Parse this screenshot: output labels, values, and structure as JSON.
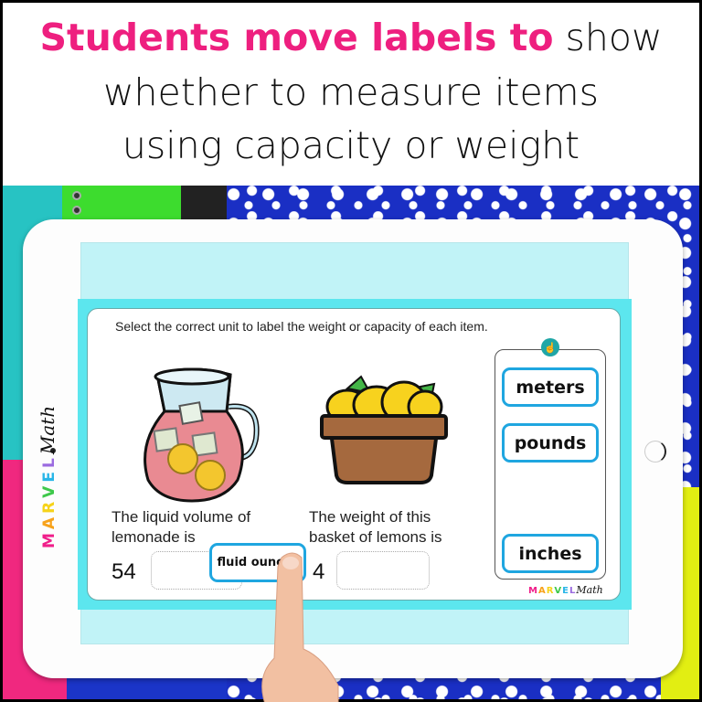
{
  "banner": {
    "line1_highlight": "Students move labels to",
    "line1_rest": " show",
    "line2": "whether to measure items",
    "line3": "using capacity or weight",
    "highlight_color": "#ee1f7f"
  },
  "brand": {
    "letters": [
      "M",
      "A",
      "R",
      "V",
      "E",
      "L"
    ],
    "letter_colors": [
      "#f01f8a",
      "#f7a21b",
      "#f6d31a",
      "#3ec84a",
      "#29b6e8",
      "#9b6be0"
    ],
    "script": "Math"
  },
  "slide": {
    "instruction": "Select the correct unit to label the weight or capacity of each item.",
    "items": [
      {
        "image": "lemonade-pitcher",
        "prompt_line1": "The liquid volume of",
        "prompt_line2": "lemonade is",
        "quantity": "54",
        "answer": ""
      },
      {
        "image": "lemon-basket",
        "prompt_line1": "The weight of this",
        "prompt_line2": "basket of lemons is",
        "quantity": "4",
        "answer": ""
      }
    ],
    "dragging_label": "fluid ounces",
    "label_bank": {
      "pin_icon": "thumbs-up-pin-icon",
      "labels": [
        "meters",
        "pounds",
        "inches"
      ]
    },
    "chip_border_color": "#1fa6e0"
  }
}
